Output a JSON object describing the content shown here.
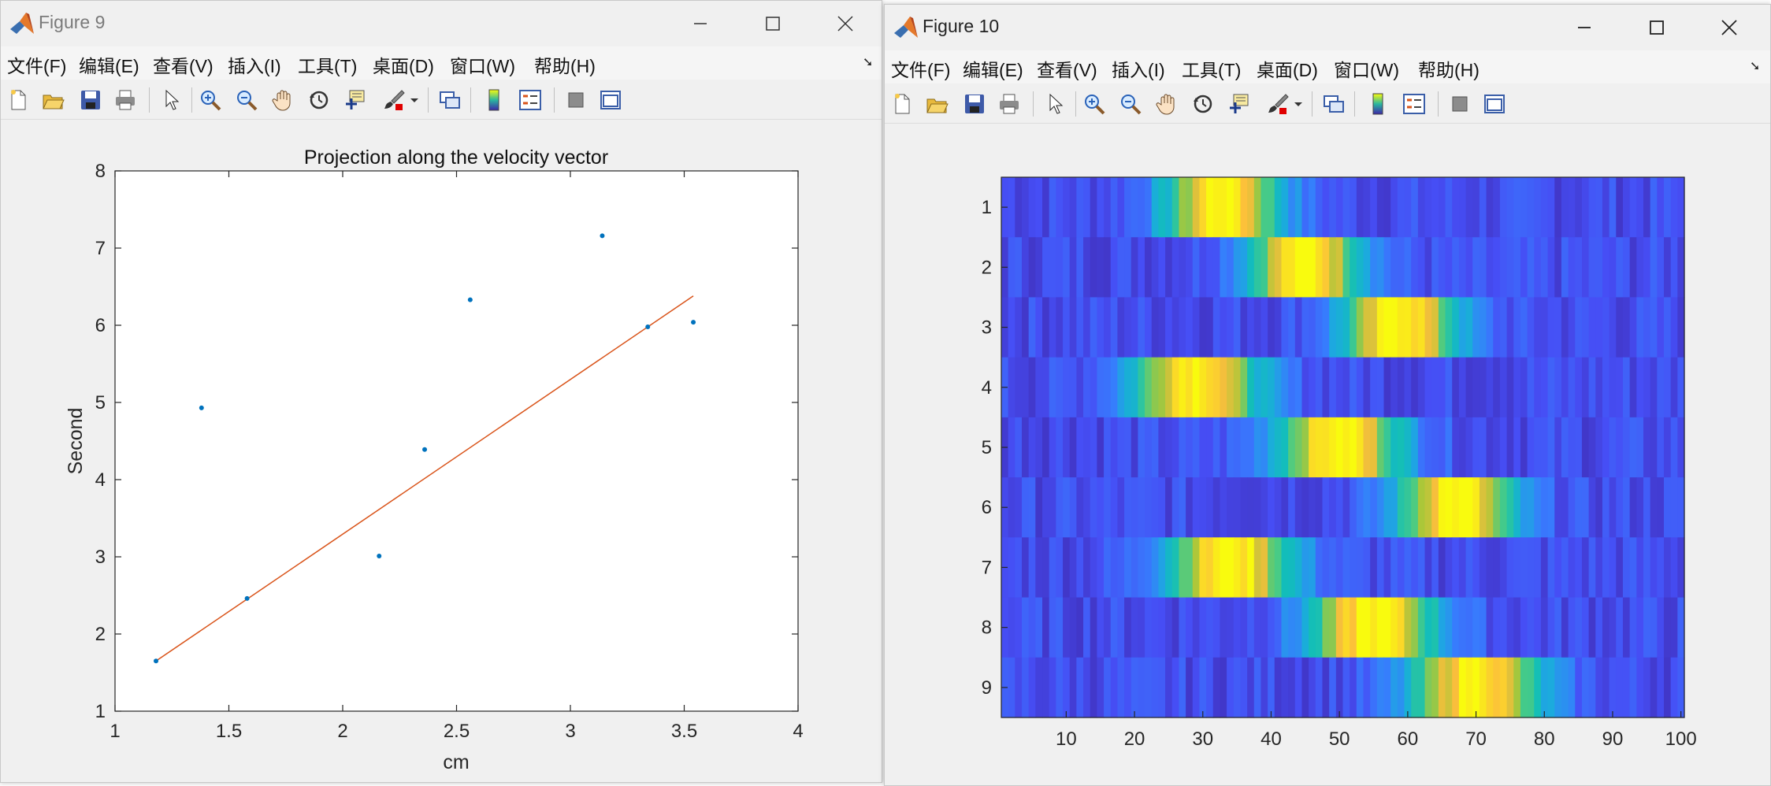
{
  "figure9": {
    "title": "Figure 9",
    "menu": [
      "文件(F)",
      "编辑(E)",
      "查看(V)",
      "插入(I)",
      "工具(T)",
      "桌面(D)",
      "窗口(W)",
      "帮助(H)"
    ],
    "toolbar_icons": [
      "new-file-icon",
      "open-file-icon",
      "save-icon",
      "print-icon",
      "pointer-icon",
      "zoom-in-icon",
      "zoom-out-icon",
      "pan-hand-icon",
      "rotate-3d-icon",
      "data-cursor-icon",
      "brush-icon",
      "link-plot-icon",
      "colorbar-icon",
      "legend-icon",
      "hide-tools-icon",
      "property-editor-icon"
    ]
  },
  "figure10": {
    "title": "Figure 10",
    "menu": [
      "文件(F)",
      "编辑(E)",
      "查看(V)",
      "插入(I)",
      "工具(T)",
      "桌面(D)",
      "窗口(W)",
      "帮助(H)"
    ]
  },
  "colors": {
    "point": "#0072bd",
    "fit_line": "#d95319"
  },
  "chart_data": [
    {
      "type": "scatter",
      "title": "Projection along the velocity vector",
      "xlabel": "cm",
      "ylabel": "Second",
      "xlim": [
        1,
        4
      ],
      "ylim": [
        1,
        8
      ],
      "xticks": [
        "1",
        "1.5",
        "2",
        "2.5",
        "3",
        "3.5",
        "4"
      ],
      "yticks": [
        "1",
        "2",
        "3",
        "4",
        "5",
        "6",
        "7",
        "8"
      ],
      "grid": false,
      "points": [
        [
          1.18,
          1.65
        ],
        [
          1.38,
          4.93
        ],
        [
          1.58,
          2.46
        ],
        [
          2.16,
          3.01
        ],
        [
          2.36,
          4.39
        ],
        [
          2.56,
          6.33
        ],
        [
          3.14,
          7.16
        ],
        [
          3.34,
          5.98
        ],
        [
          3.54,
          6.04
        ]
      ],
      "fit_line": [
        [
          1.18,
          1.65
        ],
        [
          3.54,
          6.38
        ]
      ]
    },
    {
      "type": "heatmap",
      "xlim": [
        0.5,
        100.5
      ],
      "ylim": [
        0.5,
        9.5
      ],
      "xticks": [
        "10",
        "20",
        "30",
        "40",
        "50",
        "60",
        "70",
        "80",
        "90",
        "100"
      ],
      "yticks": [
        "1",
        "2",
        "3",
        "4",
        "5",
        "6",
        "7",
        "8",
        "9"
      ],
      "colormap": "parula",
      "columns": 100,
      "rows": [
        {
          "label": "1",
          "peak_center": 33,
          "peak_width": 10
        },
        {
          "label": "2",
          "peak_center": 45,
          "peak_width": 10
        },
        {
          "label": "3",
          "peak_center": 59,
          "peak_width": 10
        },
        {
          "label": "4",
          "peak_center": 29,
          "peak_width": 11
        },
        {
          "label": "5",
          "peak_center": 50,
          "peak_width": 11
        },
        {
          "label": "6",
          "peak_center": 67,
          "peak_width": 10
        },
        {
          "label": "7",
          "peak_center": 34,
          "peak_width": 11
        },
        {
          "label": "8",
          "peak_center": 55,
          "peak_width": 11
        },
        {
          "label": "9",
          "peak_center": 70,
          "peak_width": 11
        }
      ]
    }
  ]
}
